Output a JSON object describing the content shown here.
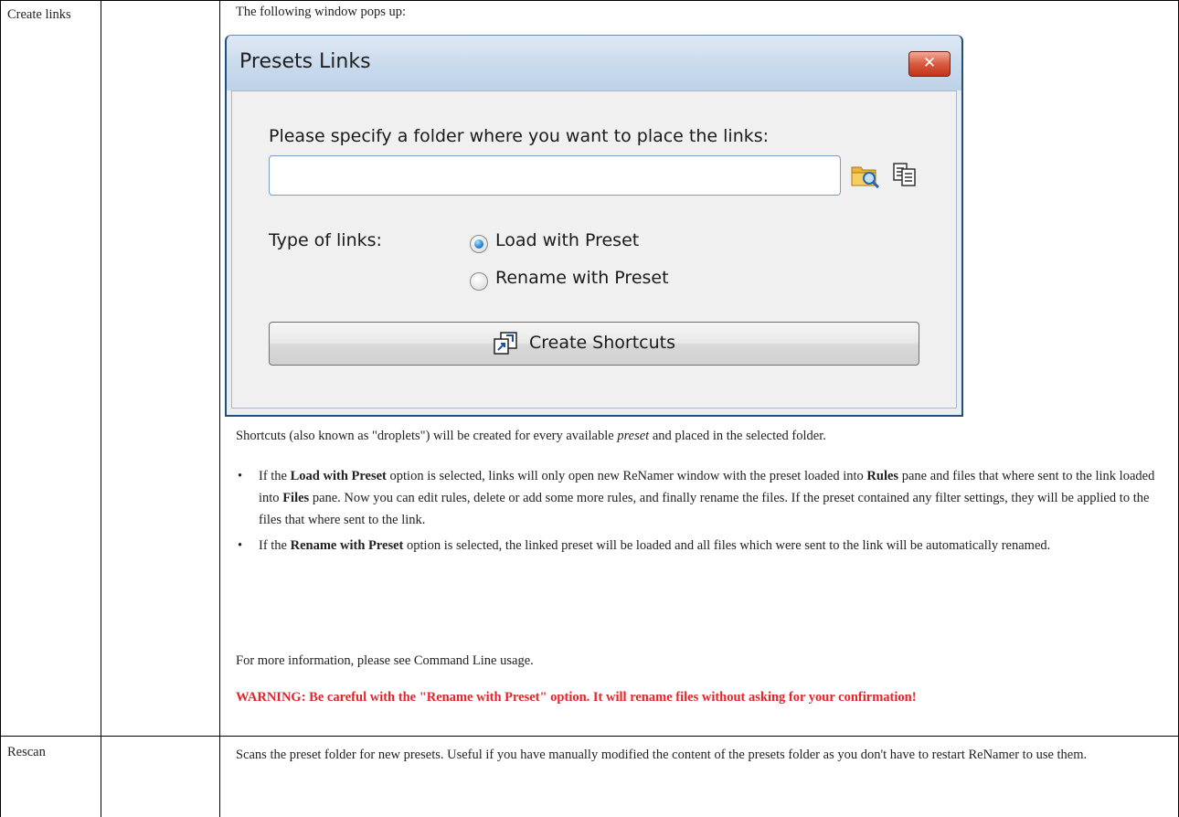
{
  "table": {
    "row1_col1": "Create links",
    "row1_intro": "The following window pops up:",
    "row2_col1": "Rescan",
    "row2_text": "Scans the preset folder for new presets. Useful if you have manually modified the content of the presets folder as you don't have to restart ReNamer to use them."
  },
  "dialog": {
    "title": "Presets Links",
    "close_label": "✕",
    "folder_prompt": "Please specify a folder where you want to place the links:",
    "folder_value": "",
    "type_label": "Type of links:",
    "radio_options": [
      {
        "label": "Load with Preset",
        "checked": true
      },
      {
        "label": "Rename with Preset",
        "checked": false
      }
    ],
    "create_button": "Create Shortcuts"
  },
  "body": {
    "shortcuts_pre": "Shortcuts (also known as \"droplets\") will be created for every available ",
    "shortcuts_em": "preset",
    "shortcuts_post": " and placed in the selected folder.",
    "bullet1": {
      "a": "If the ",
      "b": "Load with Preset",
      "c": " option is selected, links will only open new ReNamer window with the preset loaded into ",
      "d": "Rules",
      "e": " pane and files that where sent to the link loaded into ",
      "f": "Files",
      "g": " pane. Now you can edit rules, delete or add some more rules, and finally rename the files. If the preset contained any filter settings, they will be applied to the files that where sent to the link."
    },
    "bullet2": {
      "a": "If the ",
      "b": "Rename with Preset",
      "c": " option is selected, the linked preset will be loaded and all files which were sent to the link will be automatically renamed."
    },
    "more_info": "For more information, please see Command Line usage.",
    "warning": "WARNING: Be careful with the \"Rename with Preset\" option. It will rename files without asking for your confirmation!"
  }
}
